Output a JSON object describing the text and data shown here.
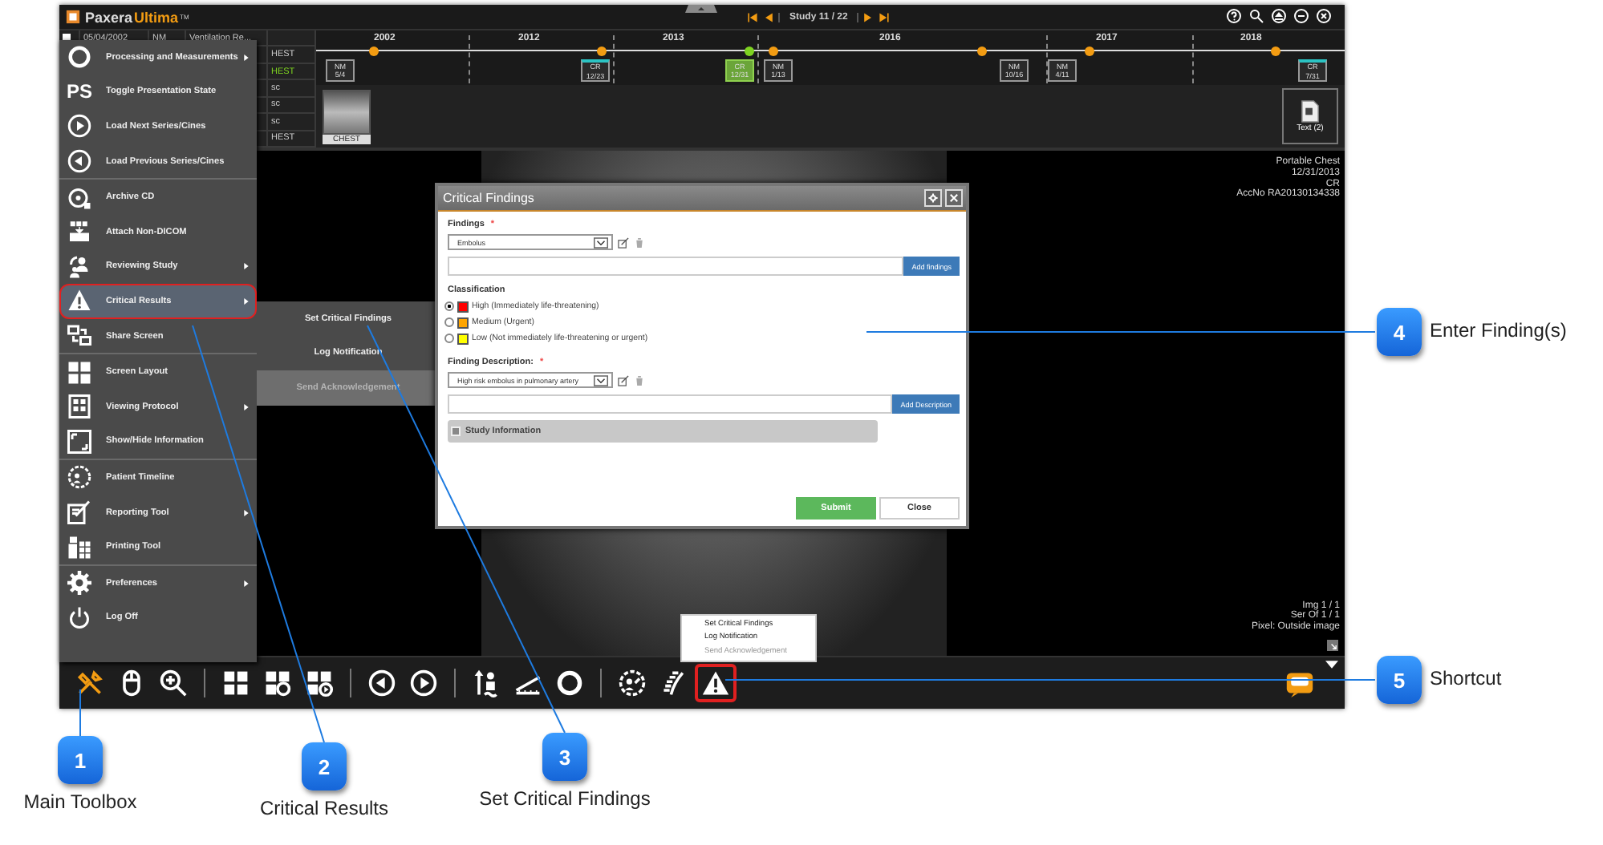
{
  "app": {
    "brand_first": "Paxera",
    "brand_second": "Ultima",
    "trademark": "TM",
    "study_counter": "Study 11 / 22"
  },
  "study_list": {
    "rows": [
      {
        "checked": false,
        "date": "05/04/2002",
        "modality": "NM",
        "description": "Ventilation Re...",
        "body_part": "",
        "selected": false
      },
      {
        "body_part": "HEST",
        "selected": false
      },
      {
        "body_part": "HEST",
        "selected": true
      },
      {
        "body_part": "sc",
        "selected": false
      },
      {
        "body_part": "sc",
        "selected": false
      },
      {
        "body_part": "sc",
        "selected": false
      },
      {
        "body_part": "HEST",
        "selected": false
      }
    ]
  },
  "timeline": {
    "years": [
      "2002",
      "2012",
      "2013",
      "2016",
      "2017",
      "2018"
    ],
    "studies": [
      {
        "modality": "NM",
        "date": "5/4",
        "selected": false,
        "flagged": false
      },
      {
        "modality": "CR",
        "date": "12/23",
        "selected": false,
        "flagged": true
      },
      {
        "modality": "CR",
        "date": "12/31",
        "selected": true,
        "flagged": false
      },
      {
        "modality": "NM",
        "date": "1/13",
        "selected": false,
        "flagged": false
      },
      {
        "modality": "NM",
        "date": "10/16",
        "selected": false,
        "flagged": false
      },
      {
        "modality": "NM",
        "date": "4/11",
        "selected": false,
        "flagged": false
      },
      {
        "modality": "CR",
        "date": "7/31",
        "selected": false,
        "flagged": true
      }
    ]
  },
  "thumbnails": [
    {
      "label": "CHEST"
    }
  ],
  "report_thumbnail": {
    "label": "Text (2)"
  },
  "viewer": {
    "info_top": [
      "Portable Chest",
      "12/31/2013",
      "CR",
      "AccNo RA20130134338"
    ],
    "info_bottom": [
      "Img 1 / 1",
      "Ser Of 1 / 1",
      "Pixel: Outside image"
    ]
  },
  "main_menu": {
    "groups": [
      [
        {
          "label": "Processing and Measurements",
          "submenu": true,
          "selected": false,
          "highlighted": false
        },
        {
          "label": "Toggle Presentation State",
          "icon_text": "PS",
          "submenu": false,
          "selected": false,
          "highlighted": false
        },
        {
          "label": "Load Next Series/Cines",
          "submenu": false,
          "selected": false,
          "highlighted": false
        },
        {
          "label": "Load Previous Series/Cines",
          "submenu": false,
          "selected": false,
          "highlighted": false
        }
      ],
      [
        {
          "label": "Archive CD",
          "submenu": false,
          "selected": false,
          "highlighted": false
        },
        {
          "label": "Attach Non-DICOM",
          "submenu": false,
          "selected": false,
          "highlighted": false
        },
        {
          "label": "Reviewing Study",
          "submenu": true,
          "selected": false,
          "highlighted": false
        },
        {
          "label": "Critical Results",
          "submenu": true,
          "selected": true,
          "highlighted": true
        },
        {
          "label": "Share Screen",
          "submenu": false,
          "selected": false,
          "highlighted": false
        }
      ],
      [
        {
          "label": "Screen Layout",
          "submenu": false,
          "selected": false,
          "highlighted": false
        },
        {
          "label": "Viewing Protocol",
          "submenu": true,
          "selected": false,
          "highlighted": false
        },
        {
          "label": "Show/Hide Information",
          "submenu": false,
          "selected": false,
          "highlighted": false
        }
      ],
      [
        {
          "label": "Patient Timeline",
          "submenu": false,
          "selected": false,
          "highlighted": false
        },
        {
          "label": "Reporting Tool",
          "submenu": true,
          "selected": false,
          "highlighted": false
        },
        {
          "label": "Printing Tool",
          "submenu": false,
          "selected": false,
          "highlighted": false
        }
      ],
      [
        {
          "label": "Preferences",
          "submenu": true,
          "selected": false,
          "highlighted": false
        },
        {
          "label": "Log Off",
          "submenu": false,
          "selected": false,
          "highlighted": false
        }
      ]
    ]
  },
  "submenu": {
    "items": [
      {
        "label": "Set Critical Findings",
        "disabled": false
      },
      {
        "label": "Log Notification",
        "disabled": false
      },
      {
        "label": "Send Acknowledgement",
        "disabled": true
      }
    ]
  },
  "shortcut_menu": {
    "items": [
      {
        "label": "Set Critical Findings",
        "disabled": false
      },
      {
        "label": "Log Notification",
        "disabled": false
      },
      {
        "label": "Send Acknowledgement",
        "disabled": true
      }
    ]
  },
  "dialog": {
    "title": "Critical Findings",
    "findings": {
      "label": "Findings",
      "required_mark": "*",
      "value": "Embolus",
      "button": "Add findings"
    },
    "classification": {
      "label": "Classification",
      "options": [
        {
          "label": "High (Immediately life-threatening)",
          "color": "#ff0000",
          "selected": true
        },
        {
          "label": "Medium (Urgent)",
          "color": "#ffa500",
          "selected": false
        },
        {
          "label": "Low (Not immediately life-threatening or urgent)",
          "color": "#ffff00",
          "selected": false
        }
      ]
    },
    "description": {
      "label": "Finding Description:",
      "required_mark": "*",
      "value": "High risk embolus in pulmonary artery",
      "button": "Add Description"
    },
    "study_information": {
      "label": "Study Information",
      "expanded": false
    },
    "submit": "Submit",
    "close": "Close"
  },
  "toolbar": {
    "groups": [
      [
        {
          "highlighted": false
        },
        {
          "highlighted": false
        },
        {
          "highlighted": false
        }
      ],
      [
        {
          "highlighted": false
        },
        {
          "highlighted": false
        },
        {
          "highlighted": false
        }
      ],
      [
        {
          "highlighted": false
        },
        {
          "highlighted": false
        }
      ],
      [
        {
          "highlighted": false
        },
        {
          "highlighted": false
        },
        {
          "highlighted": false
        }
      ],
      [
        {
          "highlighted": false
        },
        {
          "highlighted": false
        },
        {
          "highlighted": true
        }
      ]
    ]
  },
  "callouts": [
    {
      "number": "1",
      "label": "Main Toolbox"
    },
    {
      "number": "2",
      "label": "Critical Results"
    },
    {
      "number": "3",
      "label": "Set Critical Findings"
    },
    {
      "number": "4",
      "label": "Enter Finding(s)"
    },
    {
      "number": "5",
      "label": "Shortcut"
    }
  ]
}
